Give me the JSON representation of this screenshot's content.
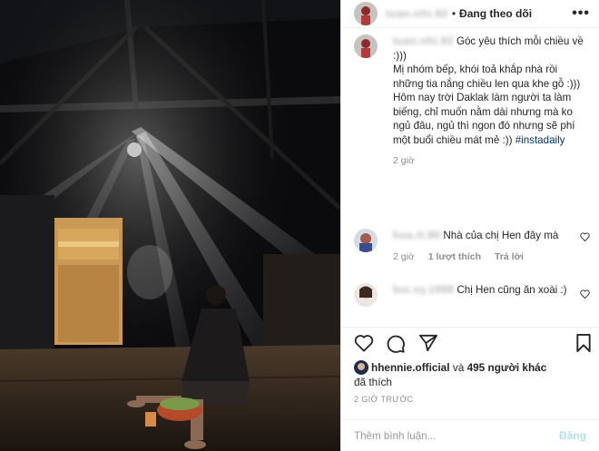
{
  "post": {
    "author_blurred": "tuan.nhi.92",
    "follow_state": "Đang theo dõi",
    "more_glyph": "•••"
  },
  "caption": {
    "author_blurred": "tuan.nhi.92",
    "lines": [
      "Góc yêu thích mỗi chiều về",
      ":)))",
      "Mị nhóm bếp, khói toả khắp nhà rồi những tia nắng chiều len qua khe gỗ :)))",
      "Hôm nay trời Daklak làm người ta làm biếng, chỉ muốn nằm dài nhưng mà ko ngủ đâu, ngủ thì ngon đó nhưng sẽ phí một buổi chiều mát mẻ :))"
    ],
    "hashtag": "#instadaily",
    "time": "2 giờ"
  },
  "comments": [
    {
      "author_blurred": "hoa.tt.90",
      "text": "Nhà của chị Hen đây mà",
      "time": "2 giờ",
      "likes": "1 lượt thích",
      "reply": "Trả lời"
    },
    {
      "author_blurred": "bui.vy.1998",
      "text": "Chị Hen cũng ăn xoài :)",
      "time": "",
      "likes": "",
      "reply": ""
    }
  ],
  "likes": {
    "user": "hhennie.official",
    "connector": "và",
    "count": "495 người khác",
    "suffix": "đã thích"
  },
  "timestamp": "2 GIỜ TRƯỚC",
  "add_comment": {
    "placeholder": "Thêm bình luận...",
    "post_label": "Đăng"
  },
  "icons": [
    "heart-icon",
    "comment-icon",
    "share-icon",
    "bookmark-icon",
    "more-icon"
  ],
  "colors": {
    "text": "#262626",
    "secondary": "#8e8e8e",
    "hashtag": "#003569",
    "post_button_disabled": "#b2dffc",
    "border": "#efefef"
  }
}
